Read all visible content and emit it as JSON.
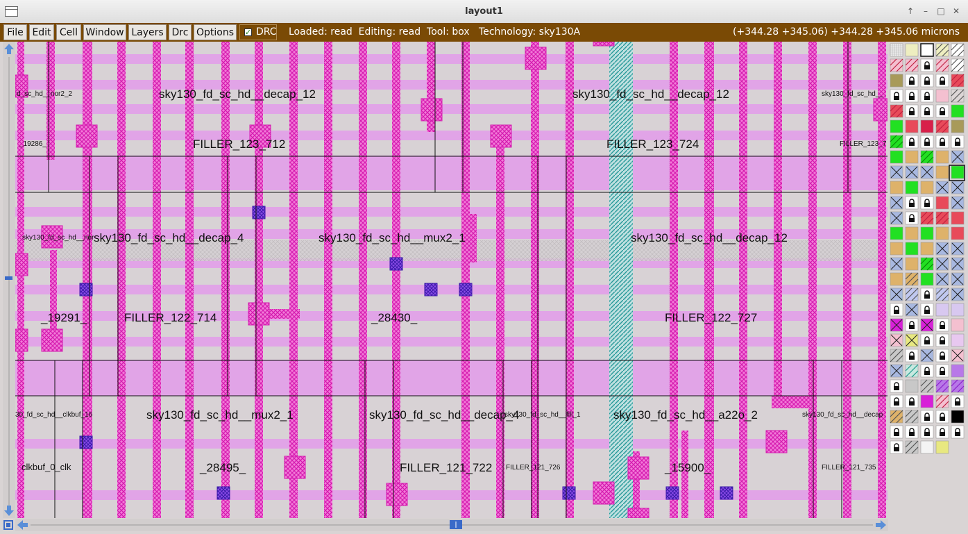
{
  "window": {
    "title": "layout1",
    "buttons": [
      "↑",
      "–",
      "□",
      "✕"
    ]
  },
  "menu": {
    "items": [
      "File",
      "Edit",
      "Cell",
      "Window",
      "Layers",
      "Drc",
      "Options"
    ],
    "drc_toggle": {
      "label": "DRC",
      "checked": true
    }
  },
  "status": {
    "text": "Loaded: read  Editing: read  Tool: box   Technology: sky130A",
    "coords": "(+344.28 +345.06) +344.28 +345.06 microns"
  },
  "layout": {
    "labels": [
      "d_sc_hd__nor2_2",
      "sky130_fd_sc_hd__decap_12",
      "sky130_fd_sc_hd__decap_12",
      "sky130_fd_sc_hd__",
      "_19286_",
      "FILLER_123_712",
      "FILLER_123_724",
      "FILLER_123_7",
      "sky130_fd_sc_hd__nor",
      "sky130_fd_sc_hd__decap_4",
      "sky130_fd_sc_hd__mux2_1",
      "sky130_fd_sc_hd__decap_12",
      "_19291_",
      "FILLER_122_714",
      "_28430_",
      "FILLER_122_727",
      "30_fd_sc_hd__clkbuf_16",
      "sky130_fd_sc_hd__mux2_1",
      "sky130_fd_sc_hd__decap_4",
      "sky130_fd_sc_hd__fill_1",
      "sky130_fd_sc_hd__a22o_2",
      "sky130_fd_sc_hd__decap",
      "clkbuf_0_clk",
      "_28495_",
      "FILLER_121_722",
      "FILLER_121_726",
      "_15900_",
      "FILLER_121_735"
    ]
  },
  "colors": {
    "menubar": "#7a4a05",
    "metal1": "#e08ee8",
    "li": "#f25ad8",
    "via": "#7a2ad8",
    "nwell_hatch": "#3aa8a8"
  },
  "palette": {
    "swatches": [
      "grid",
      "cream",
      "outline",
      "cream-hatch",
      "black-hatch",
      "pink-hatch",
      "pink-hatch",
      "lock",
      "pink-hatch",
      "black-hatch",
      "olive",
      "lock",
      "lock",
      "lock",
      "red-hatch",
      "lock",
      "lock",
      "lock",
      "pink",
      "brown-hatch",
      "red-hatch",
      "lock",
      "lock",
      "lock",
      "green",
      "green",
      "red",
      "crimson",
      "red-hatch",
      "olive",
      "green-hatch",
      "lock",
      "lock",
      "lock",
      "lock",
      "green",
      "tan",
      "green-hatch",
      "tan",
      "x-box",
      "x-box",
      "x-teal",
      "x-blue",
      "tan-dot",
      "green-dot",
      "tan-dot",
      "green-dot",
      "tan",
      "x-blue",
      "x-blue",
      "x-blue",
      "lock",
      "lock",
      "red",
      "x-blue",
      "x-purple",
      "lock",
      "red-hatch",
      "red-hatch",
      "red",
      "green",
      "tan",
      "green",
      "tan",
      "red",
      "tan",
      "green",
      "tan",
      "x-box",
      "x-teal",
      "x-teal",
      "tan",
      "green-hatch",
      "x-box",
      "x-teal",
      "tan",
      "tan-hatch",
      "green",
      "x-box",
      "x-box",
      "x-teal",
      "blue-wave",
      "lock",
      "blue-wave",
      "x-purple",
      "lock",
      "x-purple",
      "lock",
      "lavender",
      "lavender",
      "magenta-x",
      "lock",
      "magenta-x",
      "lock",
      "pink",
      "pink-x",
      "yellow-x",
      "lock",
      "lock",
      "lilac",
      "grey-hatch",
      "lock",
      "x-teal",
      "lock",
      "pink-x",
      "x-mauve",
      "teal-hatch",
      "lock",
      "lock",
      "purple-dot",
      "lock",
      "grey",
      "grey-hatch",
      "purple-hatch",
      "purple-hatch",
      "lock",
      "lock",
      "magenta-dot",
      "pink-hatch",
      "lock",
      "tan-wave",
      "grey-wave",
      "lock",
      "lock",
      "black",
      "lock",
      "lock",
      "lock",
      "lock",
      "lock",
      "lock",
      "grey-hatch",
      "white-dot",
      "yellow"
    ]
  }
}
